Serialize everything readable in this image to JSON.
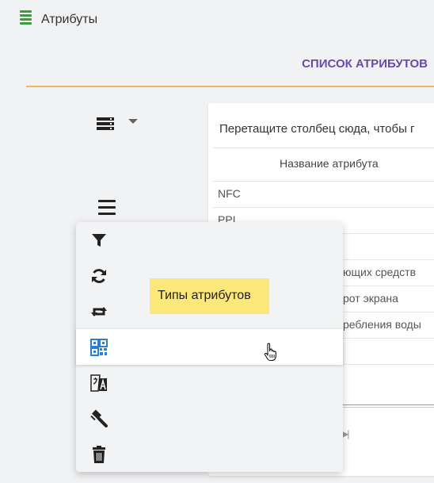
{
  "header": {
    "title": "Атрибуты",
    "icon": "list-icon",
    "icon_color": "#3d9a3d"
  },
  "tabs": {
    "active_label": "СПИСОК АТРИБУТОВ",
    "accent": "#6a4aa8",
    "underline_color": "#f0b560"
  },
  "grid": {
    "group_panel_text": "Перетащите столбец сюда, чтобы г",
    "column_header": "Название атрибута",
    "rows": [
      "NFC",
      "PPI",
      "",
      "ющих средств",
      "рот экрана",
      "ребления воды",
      "",
      ""
    ]
  },
  "menu": {
    "items": [
      {
        "icon": "filter-icon"
      },
      {
        "icon": "refresh-icon"
      },
      {
        "icon": "retweet-icon"
      },
      {
        "icon": "qrcode-icon",
        "active": true
      },
      {
        "icon": "translate-icon"
      },
      {
        "icon": "gavel-icon"
      },
      {
        "icon": "trash-icon"
      }
    ],
    "tooltip": "Типы атрибутов"
  }
}
